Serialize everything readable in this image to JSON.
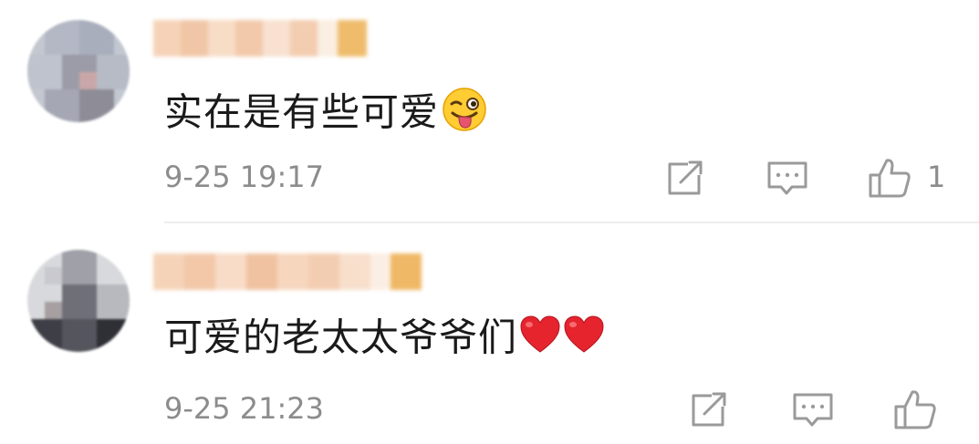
{
  "comments": [
    {
      "text": "实在是有些可爱",
      "emoji": "winking-face-with-tongue",
      "time": "9-25 19:17",
      "like_count": "1"
    },
    {
      "text": "可爱的老太太爷爷们",
      "emoji": "red-hearts",
      "time": "9-25 21:23",
      "like_count": ""
    }
  ],
  "icons": {
    "share": "share-icon",
    "reply": "reply-icon",
    "like": "thumbs-up-icon"
  },
  "colors": {
    "text": "#1a1a1a",
    "meta": "#8c8c8c",
    "icon": "#9a9a9a",
    "divider": "#ededed"
  }
}
